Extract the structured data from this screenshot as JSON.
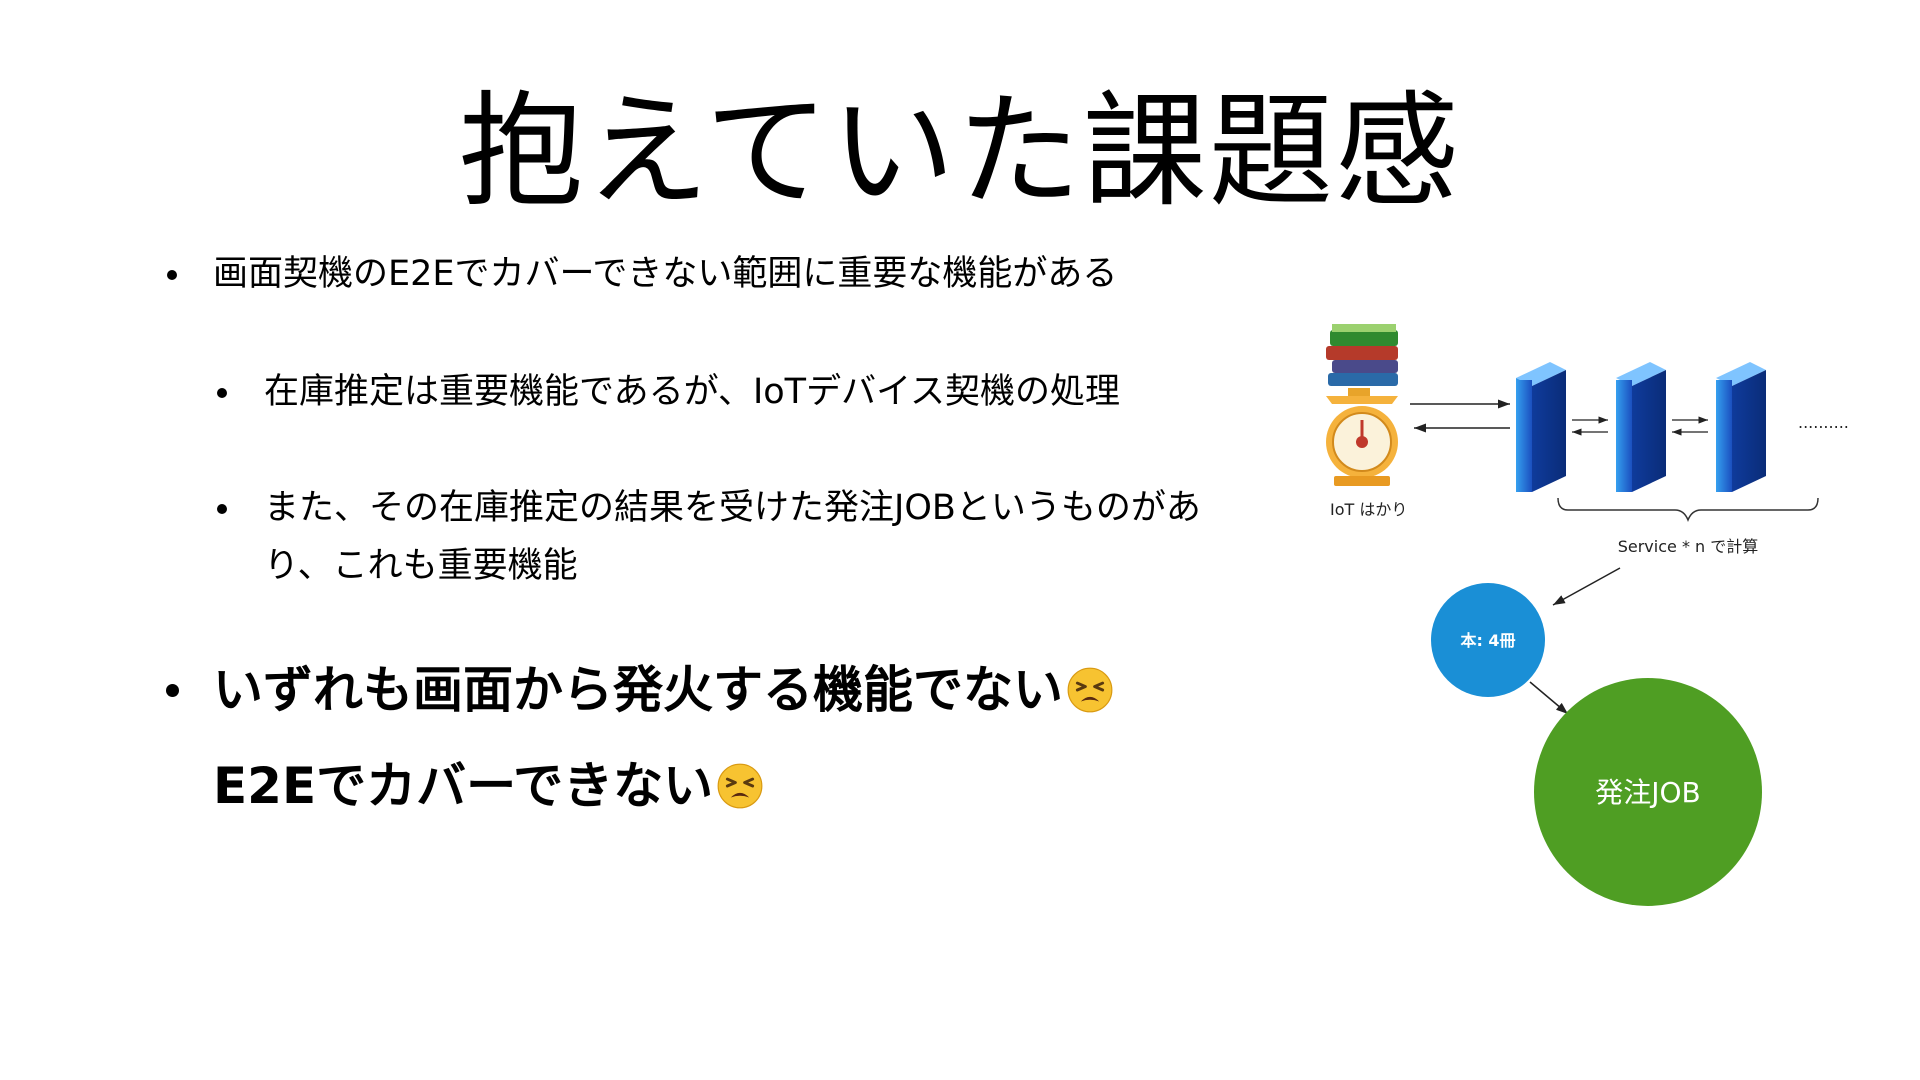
{
  "slide": {
    "title": "抱えていた課題感",
    "bullets": [
      {
        "text": "画面契機のE2Eでカバーできない範囲に重要な機能がある"
      },
      {
        "text": "在庫推定は重要機能であるが、IoTデバイス契機の処理"
      },
      {
        "line1": "また、その在庫推定の結果を受けた発注JOBというものがあ",
        "line2": "り、これも重要機能"
      },
      {
        "line1": "いずれも画面から発火する機能でない",
        "line2": "E2Eでカバーできない"
      }
    ],
    "emoji": "tired-face"
  },
  "diagram": {
    "scale_label": "IoT はかり",
    "brace_label": "Service * n で計算",
    "dots": "..........",
    "books_node_label": "本: 4冊",
    "job_node_label": "発注JOB",
    "colors": {
      "books_node": "#1a8fd6",
      "job_node": "#4f9e23",
      "server": "#1f63c8"
    }
  }
}
